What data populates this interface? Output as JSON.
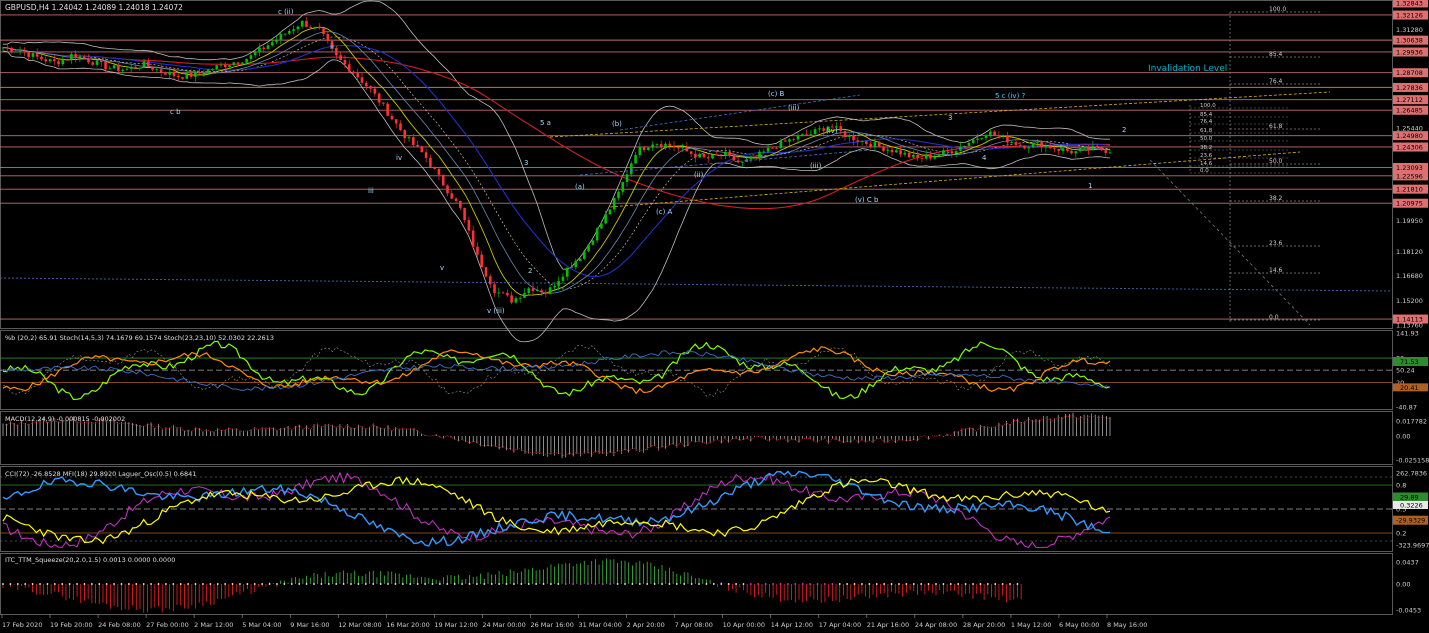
{
  "main_panel": {
    "title": "GBPUSD,H4  1.24042 1.24089 1.24018 1.24072",
    "annotation": "Invalidation Level",
    "price_ticks": [
      "1.32843",
      "1.32126",
      "1.31280",
      "1.30638",
      "1.29936",
      "1.28708",
      "1.27836",
      "1.27112",
      "1.26485",
      "1.25440",
      "1.24980",
      "1.24306",
      "1.23093",
      "1.22596",
      "1.21810",
      "1.20975",
      "1.19950",
      "1.18120",
      "1.16680",
      "1.15200",
      "1.14113",
      "1.13760"
    ],
    "fib_right": [
      "100.0",
      "85.4",
      "76.4",
      "61.8",
      "50.0",
      "38.2",
      "23.6",
      "14.6",
      "0.0"
    ],
    "fib_inner": [
      "100.0",
      "85.4",
      "76.4",
      "61.8",
      "50.0",
      "38.2",
      "23.6",
      "14.6",
      "0.0"
    ],
    "wave_labels": [
      "c (ii)",
      "ii",
      "c b",
      "iii",
      "iv",
      "v (iii)",
      "5 a",
      "3",
      "2",
      "(b)",
      "(a)",
      "(c) A",
      "(c) B",
      "(iii)",
      "(iv)",
      "(ii)",
      "(iii)",
      "(v) C b",
      "5 c (iv) ?",
      "2",
      "3",
      "4",
      "1",
      "v",
      "i"
    ]
  },
  "stoch_panel": {
    "title": "%b (20,2) 65.91  Stoch(14,5,3) 74.1679 69.1574  Stoch(23,23,10) 52.0302 22.2613",
    "ticks": [
      "141.93",
      "80",
      "50.24",
      "20",
      "-40.87"
    ],
    "marker_green": "71.53",
    "marker_orange": "20.41"
  },
  "macd_panel": {
    "title": "MACD(12,24,9) -0.000815 -0.002002",
    "ticks": [
      "0.017782",
      "0.00",
      "-0.025158"
    ]
  },
  "cci_panel": {
    "title": "CCI(72) -26.8528  MFI(18) 29.8920  Laguer_Osc(0.5) 0.6841",
    "ticks": [
      "262.7836",
      "0.8",
      "0.5",
      "0.2",
      "-323.9697"
    ],
    "marker_a": "0.3226",
    "marker_b": "-29.9329",
    "marker_c": "29.89"
  },
  "squeeze_panel": {
    "title": "ITC_TTM_Squeeze(20,2.0,1.5) 0.0013 0.0000 0.0000",
    "ticks": [
      "0.0437",
      "0.00",
      "-0.0453"
    ]
  },
  "x_axis": [
    "17 Feb 2020",
    "19 Feb 20:00",
    "24 Feb 08:00",
    "27 Feb 00:00",
    "2 Mar 12:00",
    "5 Mar 04:00",
    "9 Mar 16:00",
    "12 Mar 08:00",
    "16 Mar 20:00",
    "19 Mar 12:00",
    "24 Mar 00:00",
    "26 Mar 16:00",
    "31 Mar 04:00",
    "2 Apr 20:00",
    "7 Apr 08:00",
    "10 Apr 00:00",
    "14 Apr 12:00",
    "17 Apr 04:00",
    "21 Apr 16:00",
    "24 Apr 08:00",
    "28 Apr 20:00",
    "1 May 12:00",
    "6 May 00:00",
    "8 May 16:00"
  ],
  "colors": {
    "background": "#000000",
    "grid": "#1e2a3a",
    "hline": "#e08080",
    "bull": "#00c000",
    "bear": "#ff3030",
    "stoch_green": "#7fff00",
    "stoch_orange": "#ff8c00",
    "cci_yellow": "#ffff00",
    "cci_blue": "#3399ff",
    "mfi_magenta": "#cc33cc",
    "squeeze_red": "#ff2020",
    "squeeze_green": "#40c040",
    "invalidation": "#00b4c8"
  },
  "chart_data": {
    "type": "candlestick",
    "symbol": "GBPUSD",
    "timeframe": "H4",
    "series": [
      {
        "name": "GBPUSD,H4",
        "close_path": [
          1.302,
          1.3,
          1.296,
          1.293,
          1.298,
          1.294,
          1.29,
          1.289,
          1.292,
          1.288,
          1.285,
          1.286,
          1.29,
          1.293,
          1.296,
          1.303,
          1.31,
          1.317,
          1.312,
          1.296,
          1.287,
          1.276,
          1.262,
          1.248,
          1.238,
          1.222,
          1.207,
          1.178,
          1.158,
          1.152,
          1.16,
          1.157,
          1.17,
          1.18,
          1.197,
          1.215,
          1.24,
          1.246,
          1.244,
          1.24,
          1.236,
          1.239,
          1.233,
          1.238,
          1.244,
          1.248,
          1.251,
          1.256,
          1.25,
          1.246,
          1.243,
          1.24,
          1.236,
          1.238,
          1.241,
          1.246,
          1.252,
          1.248,
          1.244,
          1.245,
          1.242,
          1.24,
          1.242,
          1.241
        ]
      }
    ],
    "ylim": [
      1.1376,
      1.3284
    ]
  }
}
